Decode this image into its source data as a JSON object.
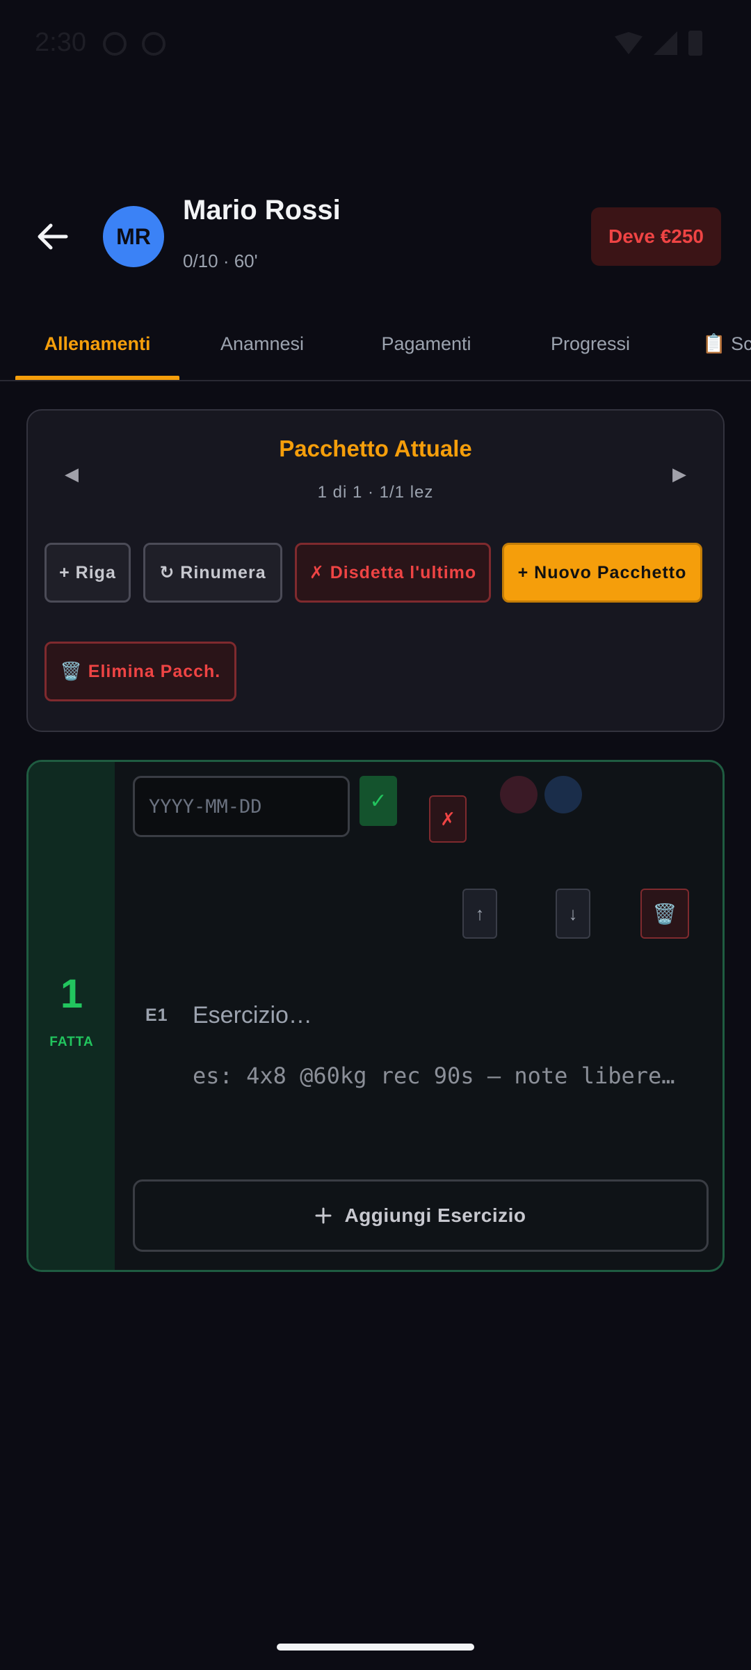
{
  "status_bar": {
    "time": "2:30"
  },
  "header": {
    "avatar_initials": "MR",
    "client_name": "Mario Rossi",
    "client_subtitle": "0/10 · 60'",
    "debt_badge": "Deve €250"
  },
  "tabs": [
    {
      "label": "Allenamenti",
      "active": true
    },
    {
      "label": "Anamnesi"
    },
    {
      "label": "Pagamenti"
    },
    {
      "label": "Progressi"
    },
    {
      "label": "📋 Sc"
    }
  ],
  "package": {
    "title": "Pacchetto Attuale",
    "subtitle": "1 di 1 · 1/1 lez",
    "prev_glyph": "◀",
    "next_glyph": "▶",
    "buttons": {
      "add_row": "+ Riga",
      "renumber": "↻ Rinumera",
      "cancel_last": "✗ Disdetta l'ultimo",
      "new_package": "+ Nuovo Pacchetto",
      "delete_package": "🗑️ Elimina Pacch."
    }
  },
  "session": {
    "number": "1",
    "status": "FATTA",
    "date_placeholder": "YYYY-MM-DD",
    "confirm_glyph": "✓",
    "cancel_glyph": "✗",
    "up_glyph": "↑",
    "down_glyph": "↓",
    "delete_glyph": "🗑️",
    "exercise": {
      "code": "E1",
      "name_placeholder": "Esercizio…",
      "notes_placeholder": "es: 4x8 @60kg rec 90s — note libere…"
    },
    "add_exercise_label": "Aggiungi Esercizio"
  },
  "colors": {
    "accent": "#f59e0b",
    "danger": "#ef4444",
    "success": "#22c55e",
    "avatar": "#3b82f6"
  }
}
